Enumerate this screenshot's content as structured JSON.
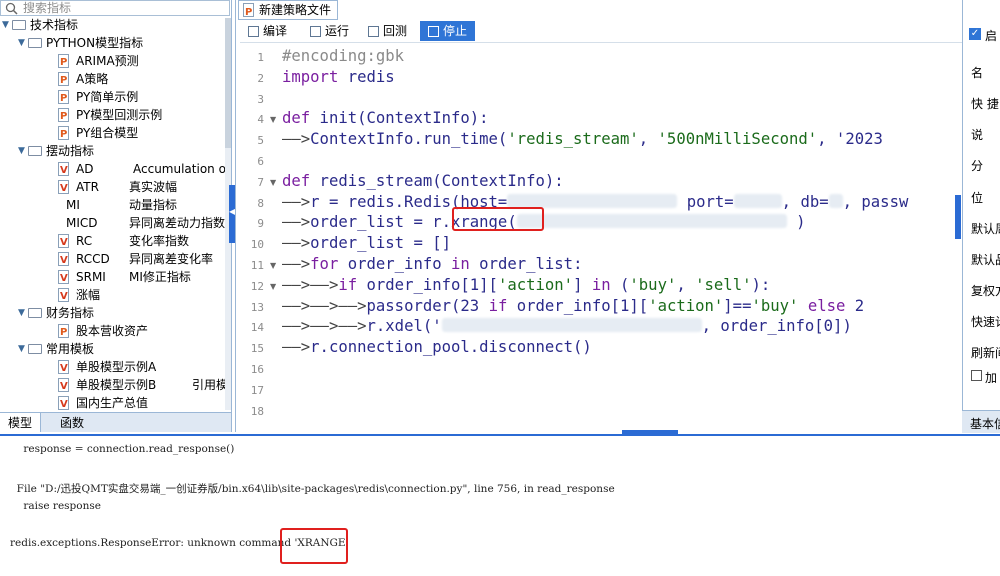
{
  "search": {
    "placeholder": "搜索指标"
  },
  "tree": [
    {
      "label": "技术指标",
      "kind": "folder",
      "level": 0
    },
    {
      "label": "PYTHON模型指标",
      "kind": "folder",
      "level": 1
    },
    {
      "label": "ARIMA预测",
      "kind": "py",
      "level": 2
    },
    {
      "label": "A策略",
      "kind": "py",
      "level": 2
    },
    {
      "label": "PY简单示例",
      "kind": "py",
      "level": 2
    },
    {
      "label": "PY模型回测示例",
      "kind": "py",
      "level": 2
    },
    {
      "label": "PY组合模型",
      "kind": "py",
      "level": 2
    },
    {
      "label": "摆动指标",
      "kind": "folder",
      "level": 1
    },
    {
      "label": "AD",
      "desc": "Accumulation or",
      "kind": "v",
      "level": 2
    },
    {
      "label": "ATR",
      "desc": "真实波幅",
      "kind": "v",
      "level": 2
    },
    {
      "label": "MI",
      "desc": "动量指标",
      "kind": "none",
      "level": 2
    },
    {
      "label": "MICD",
      "desc": "异同离差动力指数",
      "kind": "none",
      "level": 2
    },
    {
      "label": "RC",
      "desc": "变化率指数",
      "kind": "v",
      "level": 2
    },
    {
      "label": "RCCD",
      "desc": "异同离差变化率",
      "kind": "v",
      "level": 2
    },
    {
      "label": "SRMI",
      "desc": "MI修正指标",
      "kind": "v",
      "level": 2
    },
    {
      "label": "涨幅",
      "kind": "v",
      "level": 2
    },
    {
      "label": "财务指标",
      "kind": "folder",
      "level": 1
    },
    {
      "label": "股本营收资产",
      "kind": "py",
      "level": 2
    },
    {
      "label": "常用模板",
      "kind": "folder",
      "level": 1
    },
    {
      "label": "单股模型示例A",
      "kind": "v",
      "level": 2
    },
    {
      "label": "单股模型示例B",
      "desc": "引用模",
      "kind": "v",
      "level": 2
    },
    {
      "label": "国内生产总值",
      "kind": "v",
      "level": 2
    }
  ],
  "bottom_tabs": [
    "模型",
    "函数"
  ],
  "editor": {
    "file_tab": "新建策略文件",
    "toolbar": {
      "compile": "编译",
      "run": "运行",
      "backtest": "回测",
      "stop": "停止"
    }
  },
  "code_lines": [
    {
      "n": "1",
      "fold": "",
      "text": "#encoding:gbk"
    },
    {
      "n": "2",
      "fold": "",
      "text": "import redis"
    },
    {
      "n": "3",
      "fold": "",
      "text": ""
    },
    {
      "n": "4",
      "fold": "▼",
      "text": "def init(ContextInfo):"
    },
    {
      "n": "5",
      "fold": "",
      "text": "——>ContextInfo.run_time('redis_stream', '500nMilliSecond', '2023"
    },
    {
      "n": "6",
      "fold": "",
      "text": ""
    },
    {
      "n": "7",
      "fold": "▼",
      "text": "def redis_stream(ContextInfo):"
    },
    {
      "n": "8",
      "fold": "",
      "text": "——>r = redis.Redis(host=",
      "tail": "port=",
      "tail2": ", db=",
      "tail3": ", passw"
    },
    {
      "n": "9",
      "fold": "",
      "text": "——>order_list = r.xrange(",
      "tail": ")"
    },
    {
      "n": "10",
      "fold": "",
      "text": "——>order_list = []"
    },
    {
      "n": "11",
      "fold": "▼",
      "text": "——>for order_info in order_list:"
    },
    {
      "n": "12",
      "fold": "▼",
      "text": "——>——>if order_info[1]['action'] in ('buy', 'sell'):"
    },
    {
      "n": "13",
      "fold": "",
      "text": "——>——>——>passorder(23 if order_info[1]['action']=='buy' else 2"
    },
    {
      "n": "14",
      "fold": "",
      "text": "——>——>——>r.xdel('",
      "tail": ", order_info[0])"
    },
    {
      "n": "15",
      "fold": "",
      "text": "——>r.connection_pool.disconnect()"
    },
    {
      "n": "16",
      "fold": "",
      "text": ""
    },
    {
      "n": "17",
      "fold": "",
      "text": ""
    },
    {
      "n": "18",
      "fold": "",
      "text": ""
    }
  ],
  "right_panel": {
    "labels": [
      "启",
      "名",
      "快 捷",
      "说",
      "分",
      "位",
      "默认周",
      "默认品",
      "复权方",
      "快速计",
      "刷新间",
      "加",
      "基本信"
    ]
  },
  "console": {
    "lines": [
      "    response = connection.read_response()",
      "  File \"D:/迅投QMT实盘交易端_一创证券版/bin.x64\\lib\\site-packages\\redis\\connection.py\", line 756, in read_response",
      "    raise response",
      "redis.exceptions.ResponseError: unknown command 'XRANGE'"
    ]
  },
  "colors": {
    "accent": "#2b6bd4",
    "highlight": "#e0201e"
  }
}
